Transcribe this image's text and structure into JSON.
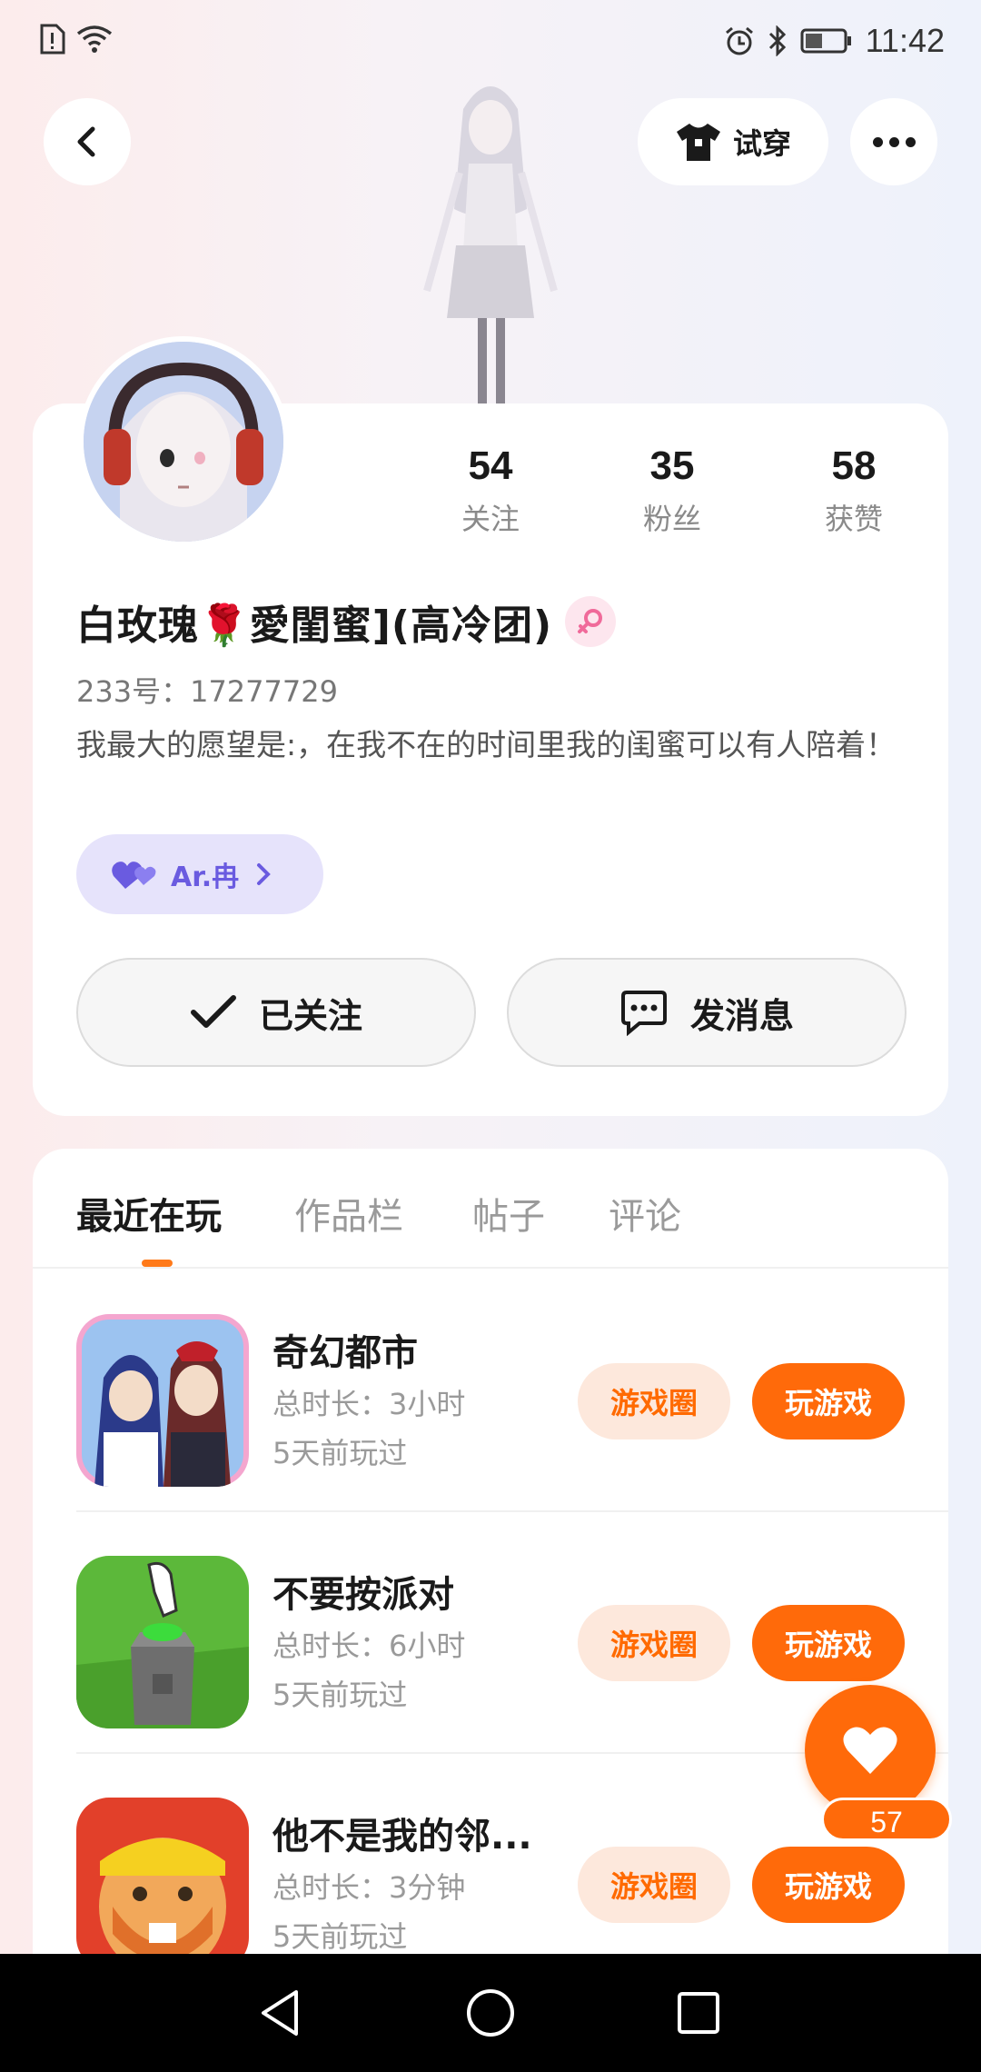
{
  "status_bar": {
    "time": "11:42"
  },
  "header": {
    "try_on_label": "试穿"
  },
  "profile": {
    "stats": [
      {
        "value": "54",
        "label": "关注"
      },
      {
        "value": "35",
        "label": "粉丝"
      },
      {
        "value": "58",
        "label": "获赞"
      }
    ],
    "nickname_part1": "白玫瑰",
    "nickname_rose": "🌹",
    "nickname_part2": "愛閨蜜](高冷团)",
    "user_id": "233号：17277729",
    "bio": "我最大的愿望是:，在我不在的时间里我的闺蜜可以有人陪着！",
    "relation_name": "Ar.冉",
    "follow_label": "已关注",
    "message_label": "发消息"
  },
  "tabs": [
    "最近在玩",
    "作品栏",
    "帖子",
    "评论"
  ],
  "games": [
    {
      "name": "奇幻都市",
      "duration": "总时长：3小时",
      "last_played": "5天前玩过",
      "circle_label": "游戏圈",
      "play_label": "玩游戏"
    },
    {
      "name": "不要按派对",
      "duration": "总时长：6小时",
      "last_played": "5天前玩过",
      "circle_label": "游戏圈",
      "play_label": "玩游戏"
    },
    {
      "name": "他不是我的邻...",
      "duration": "总时长：3分钟",
      "last_played": "5天前玩过",
      "circle_label": "游戏圈",
      "play_label": "玩游戏"
    }
  ],
  "like_count": "57",
  "colors": {
    "accent": "#ff6a0a",
    "relation_bg": "#e6e3fb",
    "relation_text": "#6a5be0"
  }
}
